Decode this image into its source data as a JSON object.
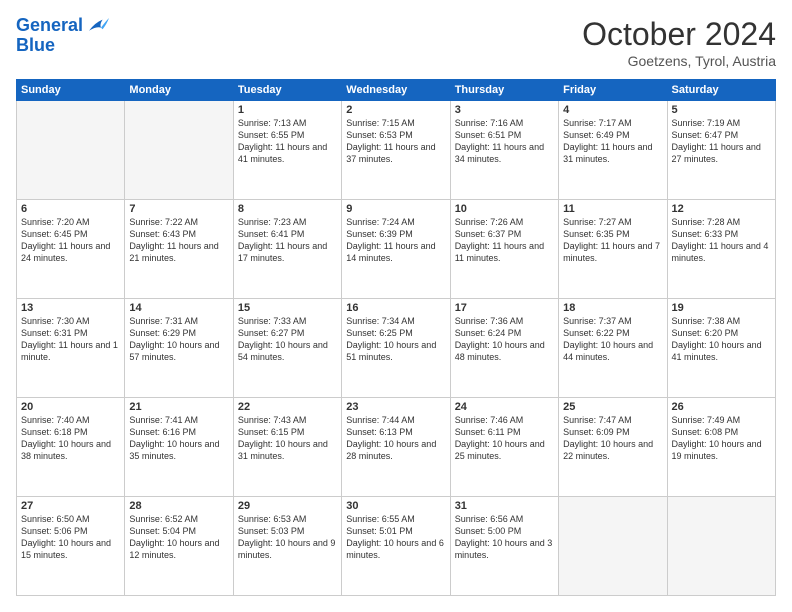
{
  "header": {
    "logo_line1": "General",
    "logo_line2": "Blue",
    "month": "October 2024",
    "location": "Goetzens, Tyrol, Austria"
  },
  "weekdays": [
    "Sunday",
    "Monday",
    "Tuesday",
    "Wednesday",
    "Thursday",
    "Friday",
    "Saturday"
  ],
  "weeks": [
    [
      {
        "day": "",
        "info": ""
      },
      {
        "day": "",
        "info": ""
      },
      {
        "day": "1",
        "info": "Sunrise: 7:13 AM\nSunset: 6:55 PM\nDaylight: 11 hours and 41 minutes."
      },
      {
        "day": "2",
        "info": "Sunrise: 7:15 AM\nSunset: 6:53 PM\nDaylight: 11 hours and 37 minutes."
      },
      {
        "day": "3",
        "info": "Sunrise: 7:16 AM\nSunset: 6:51 PM\nDaylight: 11 hours and 34 minutes."
      },
      {
        "day": "4",
        "info": "Sunrise: 7:17 AM\nSunset: 6:49 PM\nDaylight: 11 hours and 31 minutes."
      },
      {
        "day": "5",
        "info": "Sunrise: 7:19 AM\nSunset: 6:47 PM\nDaylight: 11 hours and 27 minutes."
      }
    ],
    [
      {
        "day": "6",
        "info": "Sunrise: 7:20 AM\nSunset: 6:45 PM\nDaylight: 11 hours and 24 minutes."
      },
      {
        "day": "7",
        "info": "Sunrise: 7:22 AM\nSunset: 6:43 PM\nDaylight: 11 hours and 21 minutes."
      },
      {
        "day": "8",
        "info": "Sunrise: 7:23 AM\nSunset: 6:41 PM\nDaylight: 11 hours and 17 minutes."
      },
      {
        "day": "9",
        "info": "Sunrise: 7:24 AM\nSunset: 6:39 PM\nDaylight: 11 hours and 14 minutes."
      },
      {
        "day": "10",
        "info": "Sunrise: 7:26 AM\nSunset: 6:37 PM\nDaylight: 11 hours and 11 minutes."
      },
      {
        "day": "11",
        "info": "Sunrise: 7:27 AM\nSunset: 6:35 PM\nDaylight: 11 hours and 7 minutes."
      },
      {
        "day": "12",
        "info": "Sunrise: 7:28 AM\nSunset: 6:33 PM\nDaylight: 11 hours and 4 minutes."
      }
    ],
    [
      {
        "day": "13",
        "info": "Sunrise: 7:30 AM\nSunset: 6:31 PM\nDaylight: 11 hours and 1 minute."
      },
      {
        "day": "14",
        "info": "Sunrise: 7:31 AM\nSunset: 6:29 PM\nDaylight: 10 hours and 57 minutes."
      },
      {
        "day": "15",
        "info": "Sunrise: 7:33 AM\nSunset: 6:27 PM\nDaylight: 10 hours and 54 minutes."
      },
      {
        "day": "16",
        "info": "Sunrise: 7:34 AM\nSunset: 6:25 PM\nDaylight: 10 hours and 51 minutes."
      },
      {
        "day": "17",
        "info": "Sunrise: 7:36 AM\nSunset: 6:24 PM\nDaylight: 10 hours and 48 minutes."
      },
      {
        "day": "18",
        "info": "Sunrise: 7:37 AM\nSunset: 6:22 PM\nDaylight: 10 hours and 44 minutes."
      },
      {
        "day": "19",
        "info": "Sunrise: 7:38 AM\nSunset: 6:20 PM\nDaylight: 10 hours and 41 minutes."
      }
    ],
    [
      {
        "day": "20",
        "info": "Sunrise: 7:40 AM\nSunset: 6:18 PM\nDaylight: 10 hours and 38 minutes."
      },
      {
        "day": "21",
        "info": "Sunrise: 7:41 AM\nSunset: 6:16 PM\nDaylight: 10 hours and 35 minutes."
      },
      {
        "day": "22",
        "info": "Sunrise: 7:43 AM\nSunset: 6:15 PM\nDaylight: 10 hours and 31 minutes."
      },
      {
        "day": "23",
        "info": "Sunrise: 7:44 AM\nSunset: 6:13 PM\nDaylight: 10 hours and 28 minutes."
      },
      {
        "day": "24",
        "info": "Sunrise: 7:46 AM\nSunset: 6:11 PM\nDaylight: 10 hours and 25 minutes."
      },
      {
        "day": "25",
        "info": "Sunrise: 7:47 AM\nSunset: 6:09 PM\nDaylight: 10 hours and 22 minutes."
      },
      {
        "day": "26",
        "info": "Sunrise: 7:49 AM\nSunset: 6:08 PM\nDaylight: 10 hours and 19 minutes."
      }
    ],
    [
      {
        "day": "27",
        "info": "Sunrise: 6:50 AM\nSunset: 5:06 PM\nDaylight: 10 hours and 15 minutes."
      },
      {
        "day": "28",
        "info": "Sunrise: 6:52 AM\nSunset: 5:04 PM\nDaylight: 10 hours and 12 minutes."
      },
      {
        "day": "29",
        "info": "Sunrise: 6:53 AM\nSunset: 5:03 PM\nDaylight: 10 hours and 9 minutes."
      },
      {
        "day": "30",
        "info": "Sunrise: 6:55 AM\nSunset: 5:01 PM\nDaylight: 10 hours and 6 minutes."
      },
      {
        "day": "31",
        "info": "Sunrise: 6:56 AM\nSunset: 5:00 PM\nDaylight: 10 hours and 3 minutes."
      },
      {
        "day": "",
        "info": ""
      },
      {
        "day": "",
        "info": ""
      }
    ]
  ]
}
